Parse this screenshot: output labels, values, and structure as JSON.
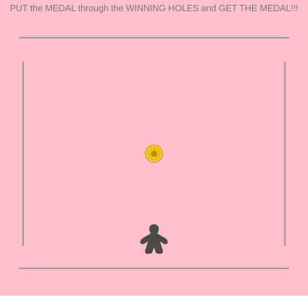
{
  "game": {
    "instruction": "PUT the MEDAL through the WINNING HOLES and GET THE MEDAL!!!",
    "colors": {
      "background": "#ffc0cb",
      "walls": "#9a9a9a",
      "text": "#7a7a7a",
      "medal_gold": "#f2c20f",
      "player": "#4a4a4a"
    },
    "objects": {
      "medal_icon": "medal-coin-icon",
      "player_icon": "meeple-player-icon"
    }
  }
}
